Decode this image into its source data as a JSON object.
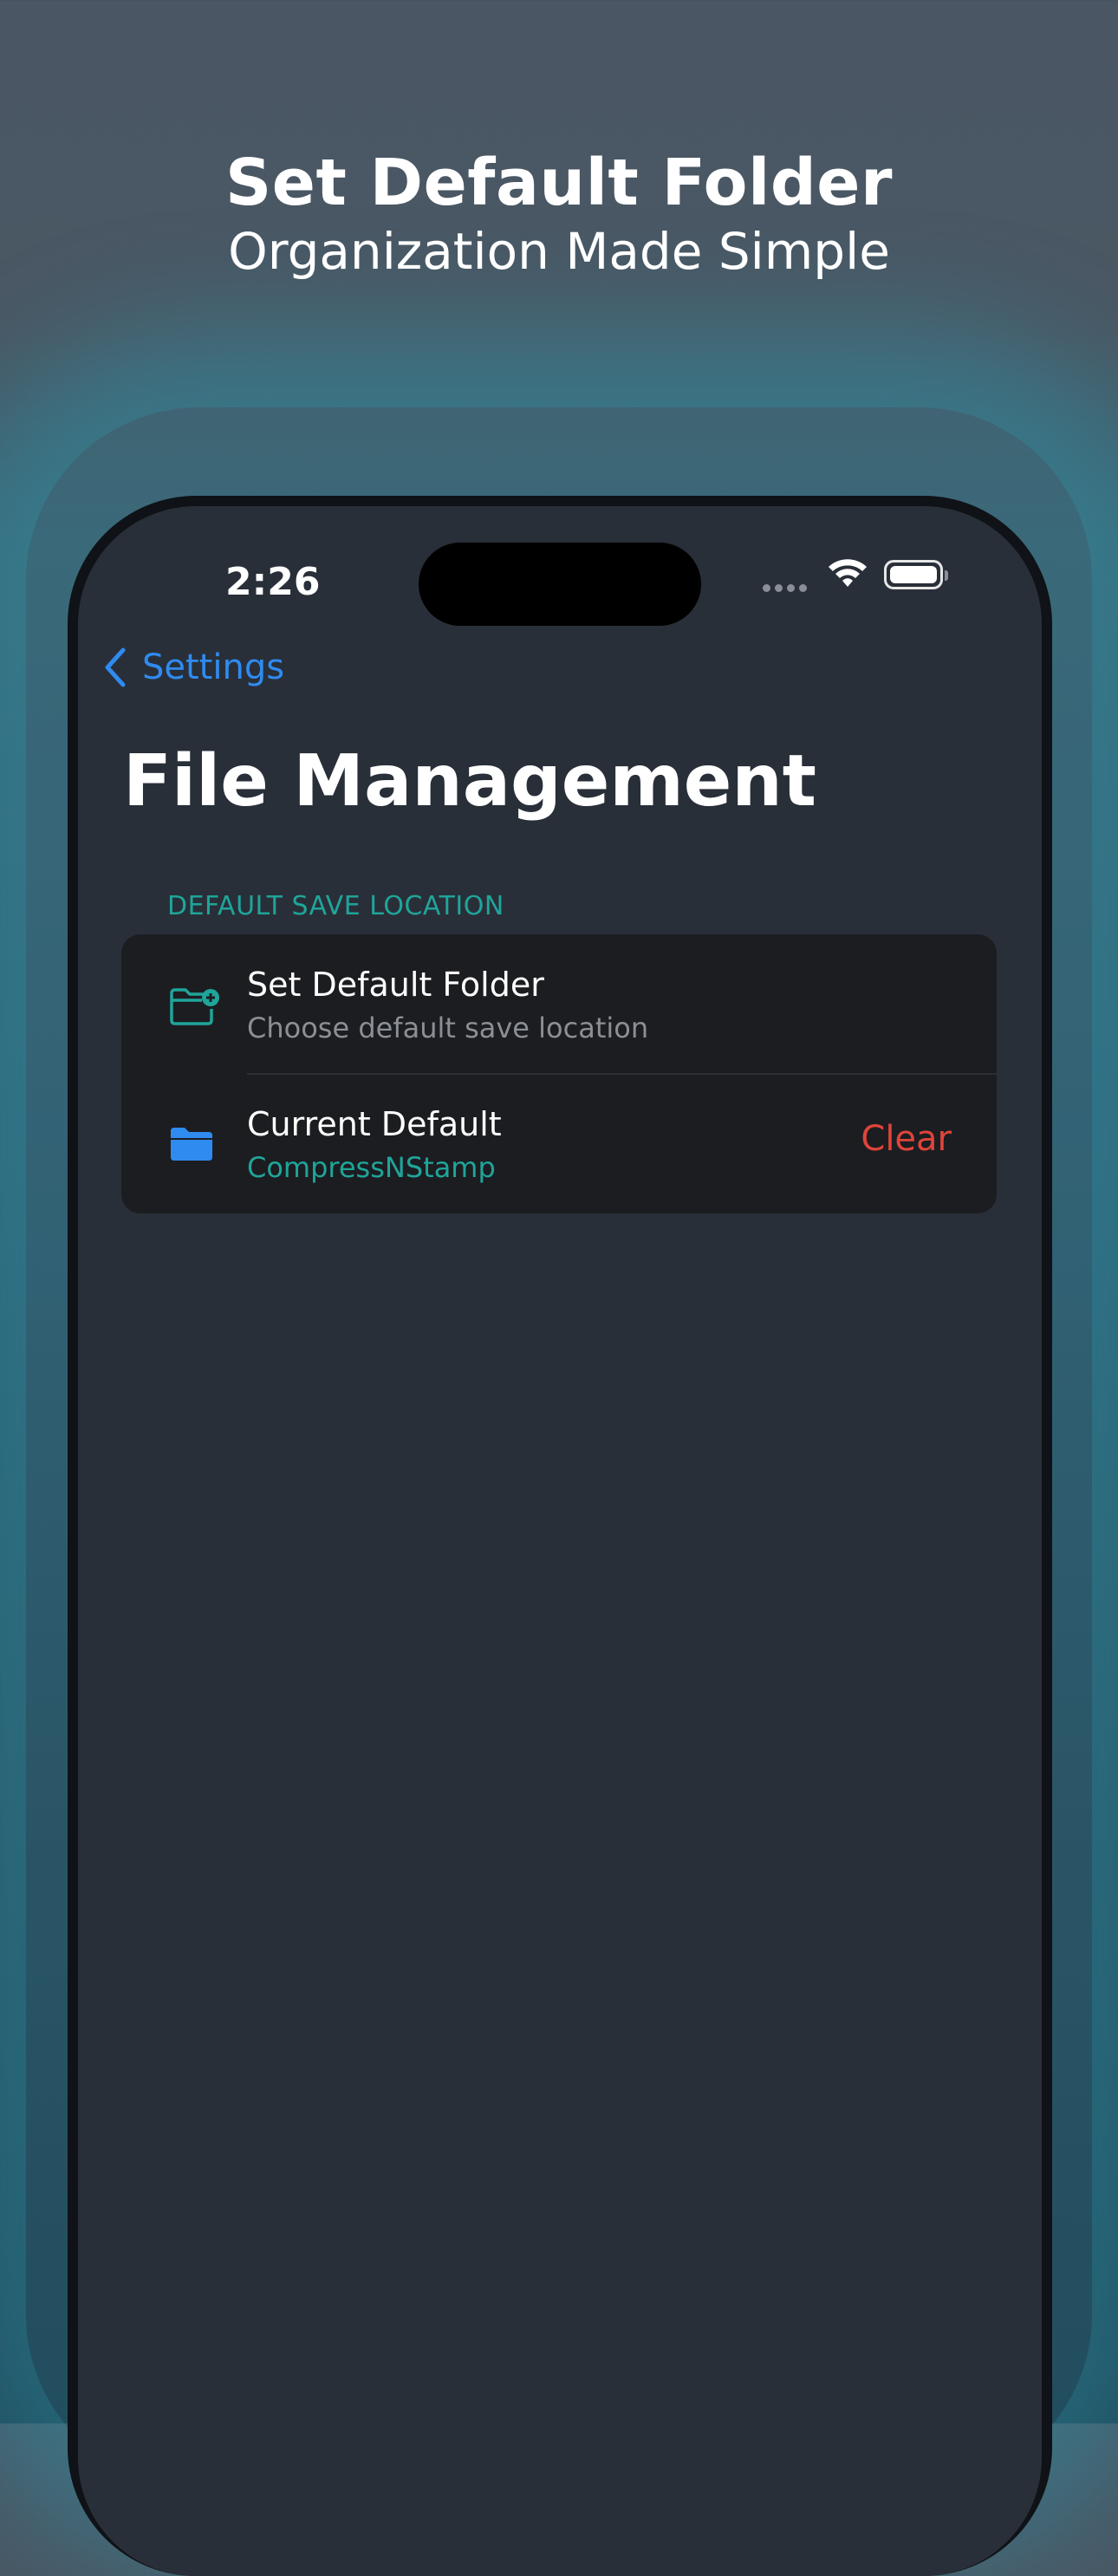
{
  "marketing": {
    "headline": "Set Default Folder",
    "subheadline": "Organization Made Simple"
  },
  "status_bar": {
    "time": "2:26",
    "icons": [
      "cellular-signal-icon",
      "wifi-icon",
      "battery-icon"
    ]
  },
  "nav": {
    "back_label": "Settings",
    "back_icon": "chevron-left-icon"
  },
  "page": {
    "title": "File Management"
  },
  "section": {
    "header": "DEFAULT SAVE LOCATION",
    "rows": [
      {
        "title": "Set Default Folder",
        "subtitle": "Choose default save location",
        "icon": "folder-badge-plus-icon"
      },
      {
        "title": "Current Default",
        "value": "CompressNStamp",
        "icon": "folder-fill-icon",
        "action_label": "Clear"
      }
    ]
  },
  "colors": {
    "accent_teal": "#1fa59a",
    "link_blue": "#2f8bf0",
    "destructive_red": "#e0443a",
    "screen_background": "#292f38",
    "card_background": "#1c1d21"
  }
}
